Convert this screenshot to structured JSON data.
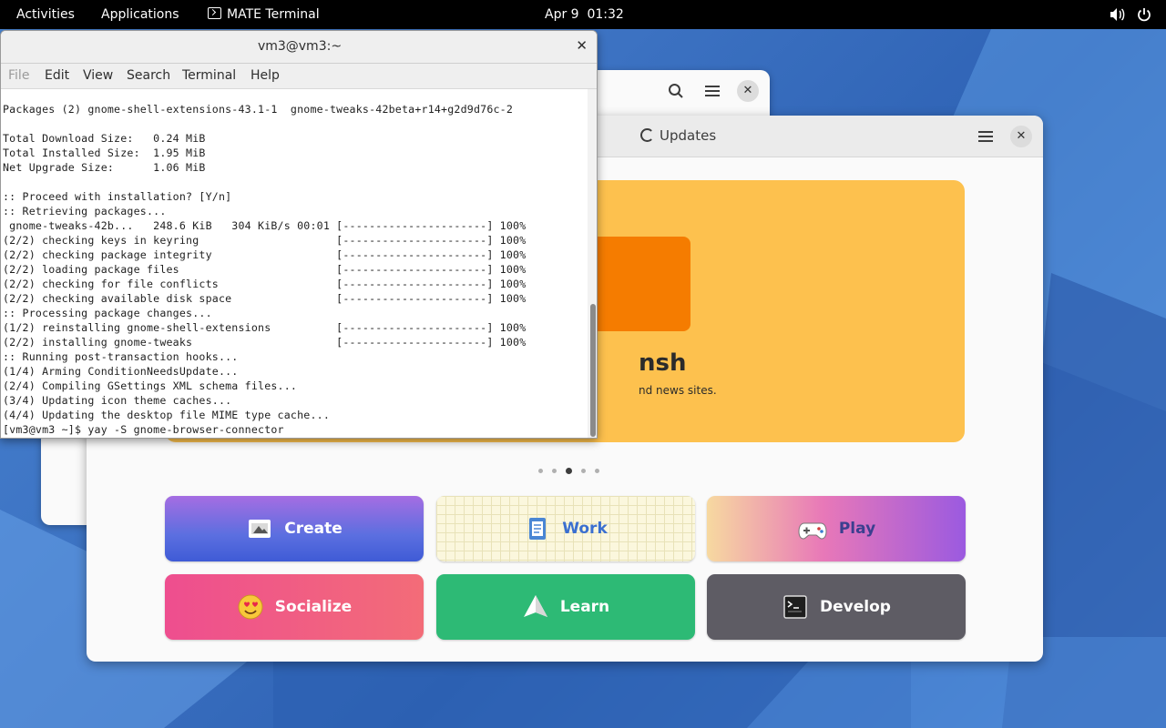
{
  "topbar": {
    "activities": "Activities",
    "applications": "Applications",
    "active_app": "MATE Terminal",
    "date": "Apr 9",
    "time": "01:32",
    "icons": [
      "volume-icon",
      "power-icon"
    ]
  },
  "software": {
    "tab_updates": "Updates",
    "banner": {
      "title": "nsh",
      "subtitle": "nd news sites.",
      "color": "#fdc14e"
    },
    "carousel_active_index": 2,
    "carousel_count": 5,
    "categories": [
      {
        "label": "Create",
        "icon": "create-icon"
      },
      {
        "label": "Work",
        "icon": "work-icon"
      },
      {
        "label": "Play",
        "icon": "gamepad-icon"
      },
      {
        "label": "Socialize",
        "icon": "heart-eyes-icon"
      },
      {
        "label": "Learn",
        "icon": "paper-plane-icon"
      },
      {
        "label": "Develop",
        "icon": "terminal-icon"
      }
    ]
  },
  "terminal": {
    "title": "vm3@vm3:~",
    "menu": [
      "File",
      "Edit",
      "View",
      "Search",
      "Terminal",
      "Help"
    ],
    "lines": [
      "Packages (2) gnome-shell-extensions-43.1-1  gnome-tweaks-42beta+r14+g2d9d76c-2",
      "",
      "Total Download Size:   0.24 MiB",
      "Total Installed Size:  1.95 MiB",
      "Net Upgrade Size:      1.06 MiB",
      "",
      ":: Proceed with installation? [Y/n]",
      ":: Retrieving packages...",
      " gnome-tweaks-42b...   248.6 KiB   304 KiB/s 00:01 [----------------------] 100%",
      "(2/2) checking keys in keyring                     [----------------------] 100%",
      "(2/2) checking package integrity                   [----------------------] 100%",
      "(2/2) loading package files                        [----------------------] 100%",
      "(2/2) checking for file conflicts                  [----------------------] 100%",
      "(2/2) checking available disk space                [----------------------] 100%",
      ":: Processing package changes...",
      "(1/2) reinstalling gnome-shell-extensions          [----------------------] 100%",
      "(2/2) installing gnome-tweaks                      [----------------------] 100%",
      ":: Running post-transaction hooks...",
      "(1/4) Arming ConditionNeedsUpdate...",
      "(2/4) Compiling GSettings XML schema files...",
      "(3/4) Updating icon theme caches...",
      "(4/4) Updating the desktop file MIME type cache...",
      "[vm3@vm3 ~]$ yay -S gnome-browser-connector"
    ]
  }
}
